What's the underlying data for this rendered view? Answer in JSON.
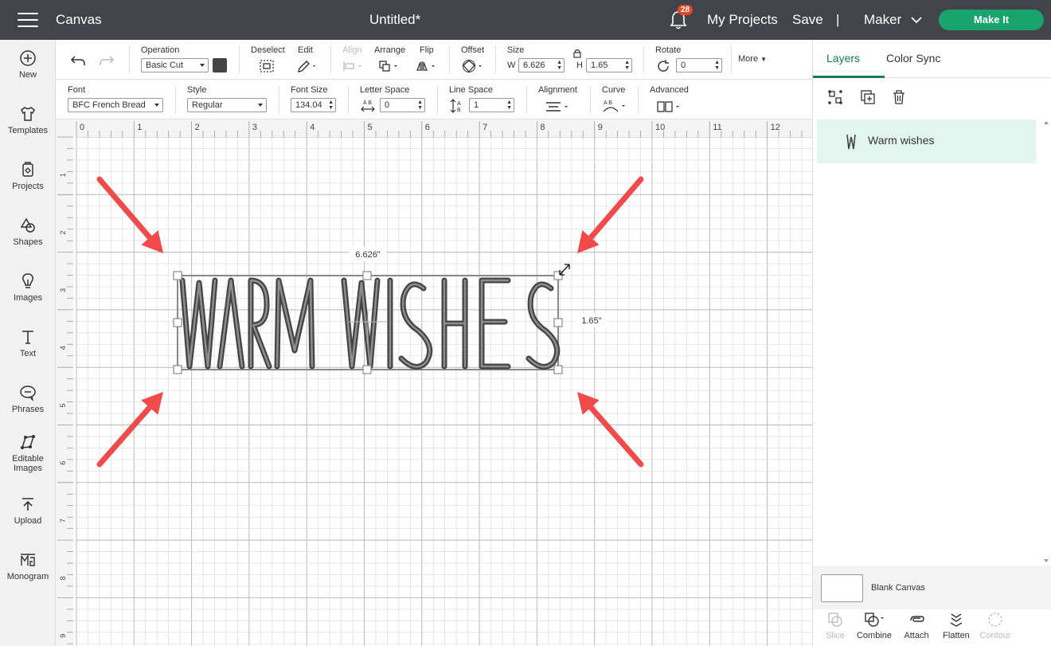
{
  "header": {
    "app_title": "Canvas",
    "doc_title": "Untitled*",
    "notification_count": "28",
    "my_projects": "My Projects",
    "save": "Save",
    "divider": "|",
    "machine": "Maker",
    "make_it": "Make It"
  },
  "sidebar": {
    "items": [
      {
        "label": "New",
        "icon": "plus-circle-icon"
      },
      {
        "label": "Templates",
        "icon": "shirt-icon"
      },
      {
        "label": "Projects",
        "icon": "projects-icon"
      },
      {
        "label": "Shapes",
        "icon": "shapes-icon"
      },
      {
        "label": "Images",
        "icon": "lightbulb-icon"
      },
      {
        "label": "Text",
        "icon": "text-icon"
      },
      {
        "label": "Phrases",
        "icon": "speech-bubble-icon"
      },
      {
        "label": "Editable",
        "label2": "Images",
        "icon": "editable-images-icon"
      },
      {
        "label": "Upload",
        "icon": "upload-icon"
      },
      {
        "label": "Monogram",
        "icon": "monogram-icon"
      }
    ]
  },
  "toolbar1": {
    "operation_label": "Operation",
    "operation_value": "Basic Cut",
    "deselect_label": "Deselect",
    "edit_label": "Edit",
    "align_label": "Align",
    "arrange_label": "Arrange",
    "flip_label": "Flip",
    "offset_label": "Offset",
    "size_label": "Size",
    "w_label": "W",
    "w_value": "6.626",
    "h_label": "H",
    "h_value": "1.65",
    "rotate_label": "Rotate",
    "rotate_value": "0",
    "more_label": "More"
  },
  "toolbar2": {
    "font_label": "Font",
    "font_value": "BFC French Bread",
    "style_label": "Style",
    "style_value": "Regular",
    "font_size_label": "Font Size",
    "font_size_value": "134.04",
    "letter_space_label": "Letter Space",
    "letter_space_value": "0",
    "line_space_label": "Line Space",
    "line_space_value": "1",
    "alignment_label": "Alignment",
    "curve_label": "Curve",
    "advanced_label": "Advanced"
  },
  "canvas": {
    "ruler_top": [
      "0",
      "1",
      "2",
      "3",
      "4",
      "5",
      "6",
      "7",
      "8",
      "9",
      "10",
      "11",
      "12"
    ],
    "ruler_left": [
      "1",
      "2",
      "3",
      "4",
      "5",
      "6",
      "7",
      "8",
      "9"
    ],
    "text_content": "WARM WISHES",
    "width_readout": "6.626\"",
    "height_readout": "1.65\"",
    "arrow_color": "#f04a4a"
  },
  "right_panel": {
    "tab_layers": "Layers",
    "tab_color_sync": "Color Sync",
    "layer_name": "Warm wishes",
    "blank_canvas": "Blank Canvas",
    "actions": [
      {
        "label": "Slice",
        "enabled": false
      },
      {
        "label": "Combine",
        "enabled": true
      },
      {
        "label": "Attach",
        "enabled": true
      },
      {
        "label": "Flatten",
        "enabled": true
      },
      {
        "label": "Contour",
        "enabled": false
      }
    ]
  }
}
